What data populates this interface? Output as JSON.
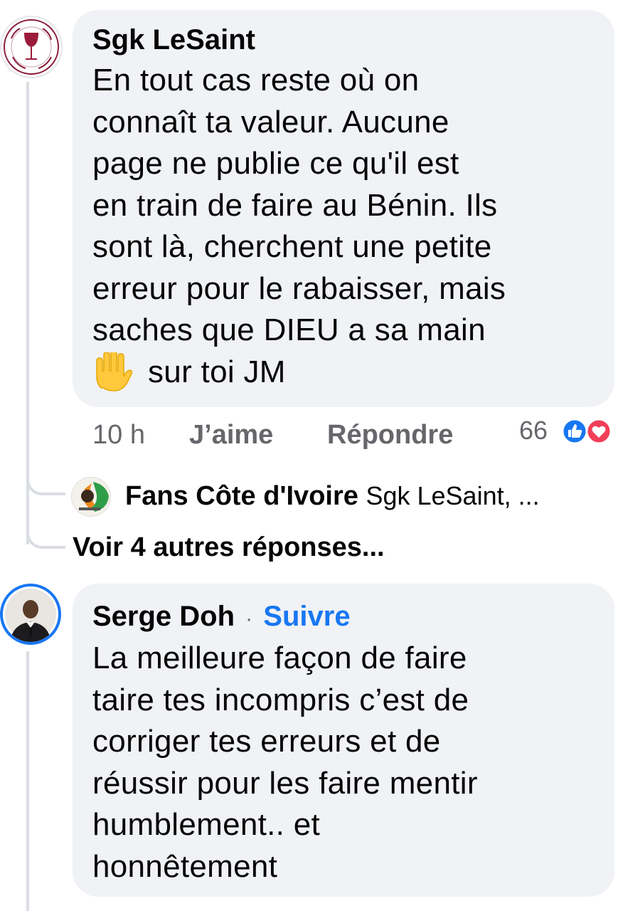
{
  "comment1": {
    "author": "Sgk LeSaint",
    "lines": [
      "En tout cas reste où on",
      "connaît ta valeur. Aucune",
      "page ne publie ce qu'il est",
      "en train de faire au Bénin. Ils",
      "sont là, cherchent une petite",
      "erreur pour le rabaisser, mais",
      "saches que DIEU a sa main"
    ],
    "last_line_text": "sur toi JM",
    "emoji_name": "raised-hand-emoji",
    "time": "10 h",
    "like_label": "J’aime",
    "reply_label": "Répondre",
    "reaction_count": "66",
    "reaction_icons": [
      "like-reaction-icon",
      "love-reaction-icon"
    ]
  },
  "reply_preview": {
    "author": "Fans Côte d'Ivoire",
    "snippet": "Sgk LeSaint, ..."
  },
  "more_replies_label": "Voir 4 autres réponses...",
  "comment2": {
    "author": "Serge Doh",
    "separator": "·",
    "follow_label": "Suivre",
    "lines": [
      "La meilleure façon de faire",
      "taire tes incompris c’est de",
      "corriger tes erreurs et de",
      "réussir pour les faire mentir",
      "humblement.. et",
      "honnêtement"
    ]
  },
  "colors": {
    "bubble": "#f0f2f5",
    "accent": "#1877f2",
    "meta_text": "#65676b",
    "love": "#f33e58",
    "thread_line": "#dadde1"
  }
}
